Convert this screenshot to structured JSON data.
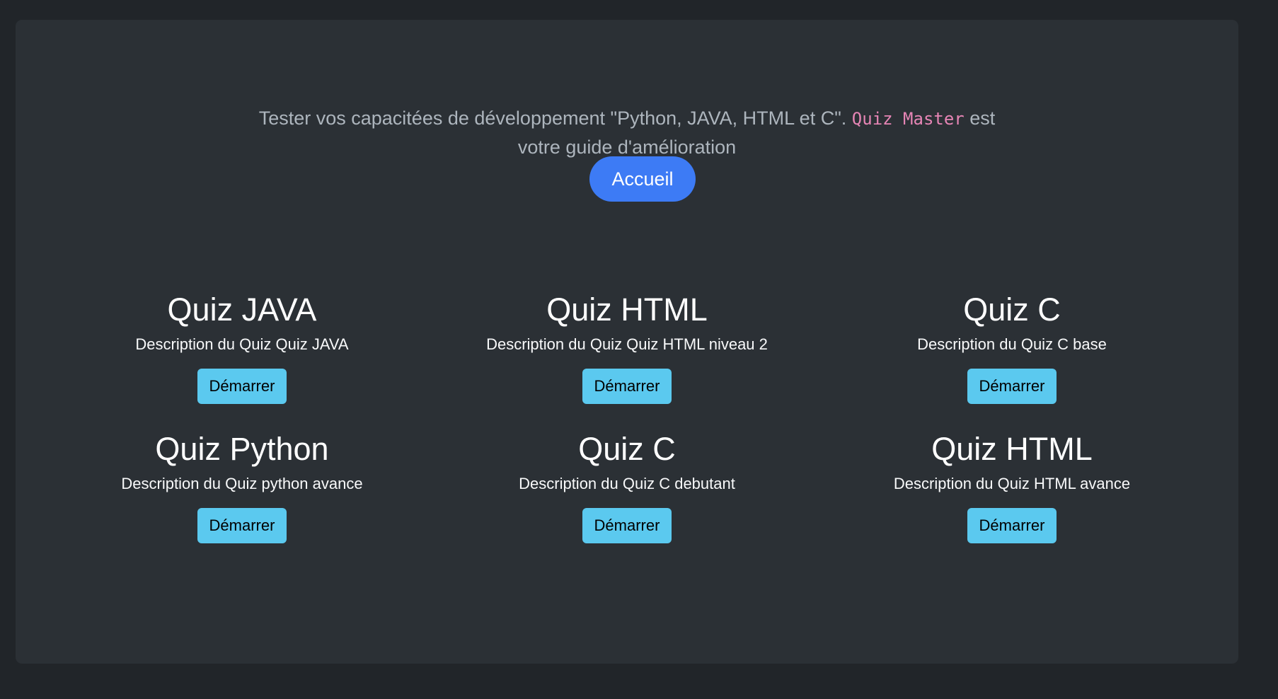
{
  "intro": {
    "text_before": "Tester vos capacitées de développement \"Python, JAVA, HTML et C\". ",
    "brand": "Quiz Master",
    "text_after": " est",
    "line2": "votre guide d'amélioration"
  },
  "home_button": {
    "label": "Accueil"
  },
  "quizzes": [
    {
      "title": "Quiz JAVA",
      "description": "Description du Quiz Quiz JAVA",
      "button": "Démarrer"
    },
    {
      "title": "Quiz HTML",
      "description": "Description du Quiz Quiz HTML niveau 2",
      "button": "Démarrer"
    },
    {
      "title": "Quiz C",
      "description": "Description du Quiz C base",
      "button": "Démarrer"
    },
    {
      "title": "Quiz Python",
      "description": "Description du Quiz python avance",
      "button": "Démarrer"
    },
    {
      "title": "Quiz C",
      "description": "Description du Quiz C debutant",
      "button": "Démarrer"
    },
    {
      "title": "Quiz HTML",
      "description": "Description du Quiz HTML avance",
      "button": "Démarrer"
    }
  ],
  "colors": {
    "page_background": "#212529",
    "panel_background": "#2b3035",
    "primary": "#3d7bf5",
    "info": "#5bc9ef",
    "code_pink": "#e685b5"
  }
}
